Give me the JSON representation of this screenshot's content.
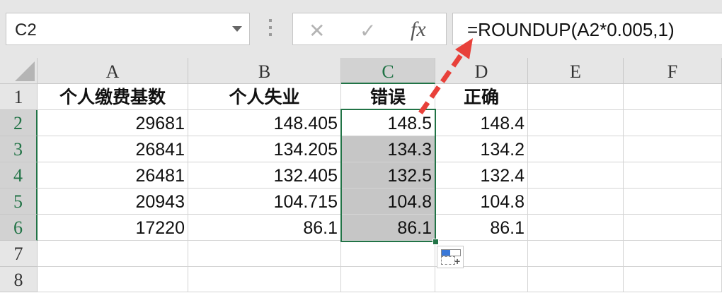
{
  "namebox": {
    "value": "C2"
  },
  "formula_bar": {
    "cancel_icon": "✕",
    "enter_icon": "✓",
    "fx_label": "fx",
    "formula": "=ROUNDUP(A2*0.005,1)"
  },
  "columns": [
    "A",
    "B",
    "C",
    "D",
    "E",
    "F"
  ],
  "rows": [
    "1",
    "2",
    "3",
    "4",
    "5",
    "6",
    "7",
    "8"
  ],
  "cells": [
    [
      "个人缴费基数",
      "个人失业",
      "错误",
      "正确",
      "",
      ""
    ],
    [
      "29681",
      "148.405",
      "148.5",
      "148.4",
      "",
      ""
    ],
    [
      "26841",
      "134.205",
      "134.3",
      "134.2",
      "",
      ""
    ],
    [
      "26481",
      "132.405",
      "132.5",
      "132.4",
      "",
      ""
    ],
    [
      "20943",
      "104.715",
      "104.8",
      "104.8",
      "",
      ""
    ],
    [
      "17220",
      "86.1",
      "86.1",
      "86.1",
      "",
      ""
    ],
    [
      "",
      "",
      "",
      "",
      "",
      ""
    ],
    [
      "",
      "",
      "",
      "",
      "",
      ""
    ]
  ],
  "colors": {
    "accent": "#217346",
    "annotation_arrow": "#e8413a",
    "selection_fill": "#c6c6c6"
  }
}
